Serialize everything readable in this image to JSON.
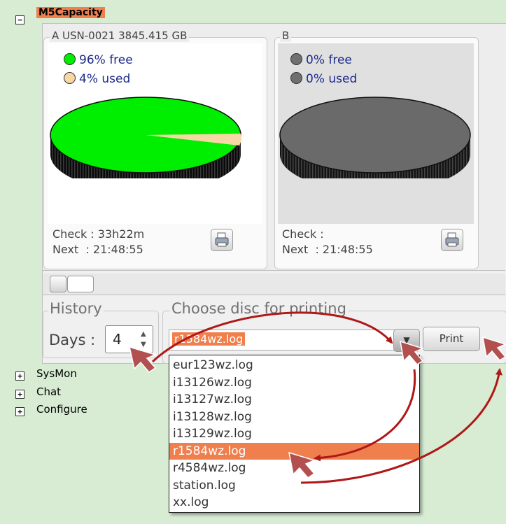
{
  "tree": {
    "root": {
      "expander": "−",
      "label": "M5Capacity"
    },
    "others": [
      {
        "expander": "+",
        "label": "SysMon"
      },
      {
        "expander": "+",
        "label": "Chat"
      },
      {
        "expander": "+",
        "label": "Configure"
      }
    ]
  },
  "discs": [
    {
      "title": "A USN-0021  3845.415 GB",
      "legend": [
        {
          "label": "96% free",
          "color": "#00ee00"
        },
        {
          "label": "4% used",
          "color": "#f7d7a3"
        }
      ],
      "pie": {
        "free_pct": 96,
        "used_pct": 4
      },
      "check": "Check : 33h22m",
      "next": "Next  : 21:48:55"
    },
    {
      "title": "B",
      "legend": [
        {
          "label": "0% free",
          "color": "#707070"
        },
        {
          "label": "0% used",
          "color": "#707070"
        }
      ],
      "pie": {
        "free_pct": 0,
        "used_pct": 0
      },
      "check": "Check :",
      "next": "Next  : 21:48:55"
    }
  ],
  "history": {
    "title": "History",
    "days_label": "Days :",
    "days_value": "4"
  },
  "print": {
    "title": "Choose disc for printing",
    "selected": "r1584wz.log",
    "button": "Print",
    "options": [
      "eur123wz.log",
      "i13126wz.log",
      "i13127wz.log",
      "i13128wz.log",
      "i13129wz.log",
      "r1584wz.log",
      "r4584wz.log",
      "station.log",
      "xx.log"
    ],
    "highlighted_index": 5
  },
  "icons": {
    "printer": "printer-icon",
    "dropdown": "chevron-down-icon",
    "spin_up": "spin-up-icon",
    "spin_down": "spin-down-icon",
    "cursor": "pointer-cursor-icon"
  },
  "colors": {
    "background": "#d7ecd3",
    "accent": "#ef7f4c",
    "free": "#00ee00",
    "used": "#f7d7a3",
    "arrow": "#b01818"
  }
}
